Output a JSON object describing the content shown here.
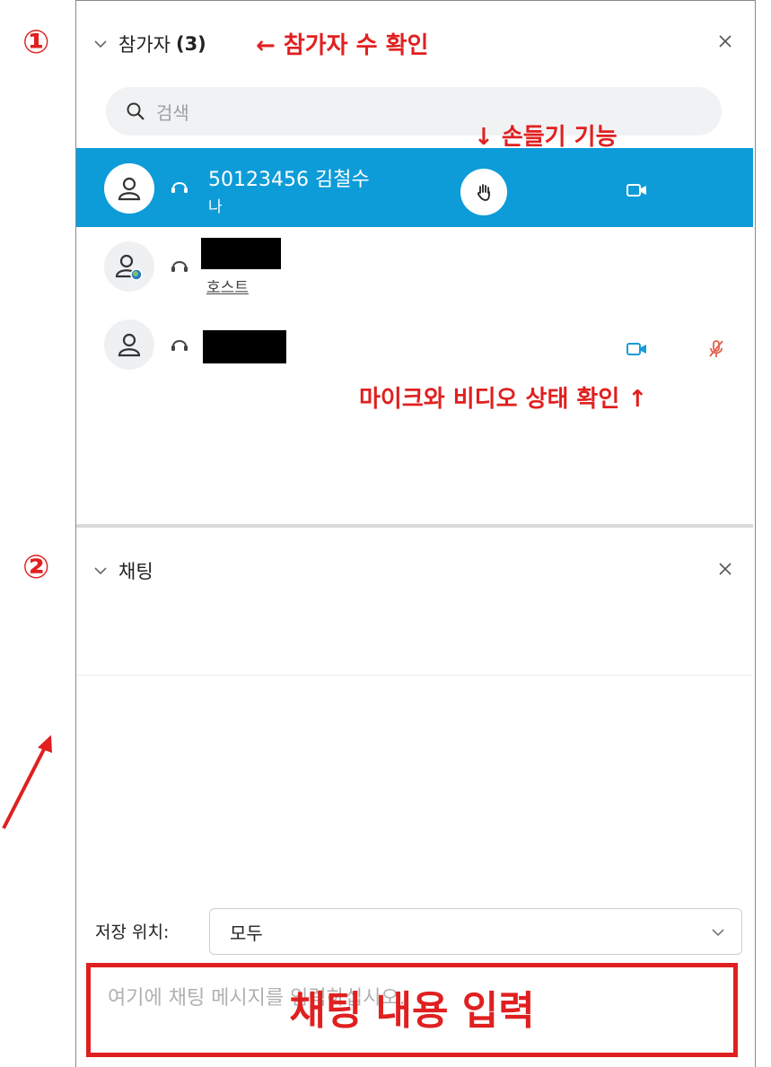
{
  "annotations": {
    "num_1": "①",
    "num_2": "②",
    "participant_count": "← 참가자 수 확인",
    "raise_hand": "↓ 손들기 기능",
    "mic_video_status": "마이크와 비디오 상태 확인 ↑",
    "chat_input": "채팅 내용 입력"
  },
  "participants_panel": {
    "title": "참가자",
    "count": "(3)",
    "search_placeholder": "검색",
    "participants": [
      {
        "name": "50123456 김철수",
        "sub": "나",
        "selected": true,
        "hand_raised": true,
        "video_on": true
      },
      {
        "name": "",
        "sub": "호스트",
        "selected": false,
        "redacted": true
      },
      {
        "name": "",
        "sub": "",
        "selected": false,
        "redacted": true,
        "video_on": true,
        "mic_muted": true
      }
    ]
  },
  "chat_panel": {
    "title": "채팅",
    "save_label": "저장 위치:",
    "recipient": "모두",
    "input_placeholder": "여기에 채팅 메시지를 입력하십시오."
  },
  "colors": {
    "accent": "#0d9cd8",
    "annotation_red": "#e02020",
    "video_icon": "#1a9bd8",
    "mic_muted": "#e0604a"
  },
  "icons": [
    "chevron-down-icon",
    "close-icon",
    "search-icon",
    "avatar-icon",
    "headset-icon",
    "hand-icon",
    "video-icon",
    "mic-muted-icon",
    "arrow-icon"
  ]
}
